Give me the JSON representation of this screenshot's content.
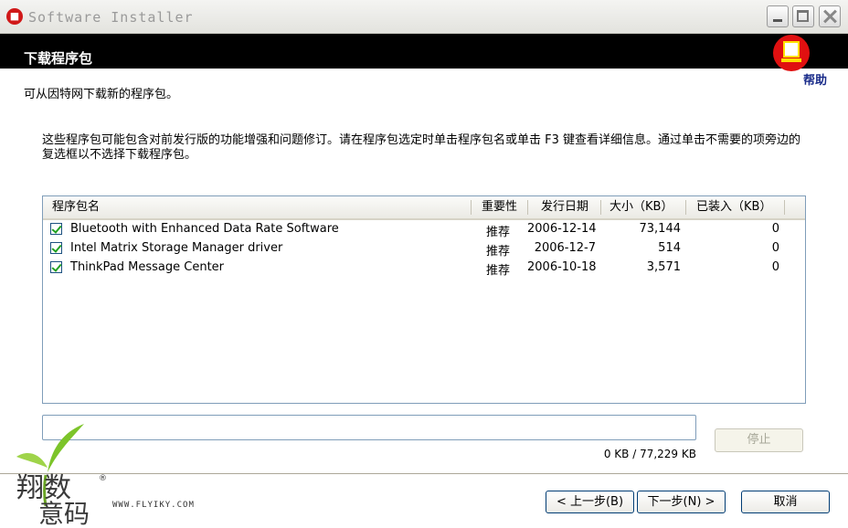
{
  "window": {
    "title": "Software Installer",
    "icon": "installer-icon"
  },
  "header": {
    "title": "下载程序包",
    "help_label": "帮助"
  },
  "subtitle": "可从因特网下载新的程序包。",
  "description": "这些程序包可能包含对前发行版的功能增强和问题修订。请在程序包选定时单击程序包名或单击 F3 键查看详细信息。通过单击不需要的项旁边的复选框以不选择下载程序包。",
  "list": {
    "columns": [
      "程序包名",
      "重要性",
      "发行日期",
      "大小（KB）",
      "已装入（KB）"
    ],
    "rows": [
      {
        "checked": true,
        "name": "Bluetooth with Enhanced Data Rate Software",
        "importance": "推荐",
        "date": "2006-12-14",
        "size": "73,144",
        "loaded": "0"
      },
      {
        "checked": true,
        "name": "Intel Matrix Storage Manager driver",
        "importance": "推荐",
        "date": "2006-12-7",
        "size": "514",
        "loaded": "0"
      },
      {
        "checked": true,
        "name": "ThinkPad Message Center",
        "importance": "推荐",
        "date": "2006-10-18",
        "size": "3,571",
        "loaded": "0"
      }
    ]
  },
  "progress": {
    "fraction": 0,
    "size_text": "0 KB / 77,229 KB"
  },
  "buttons": {
    "stop": "停止",
    "back": "< 上一步(B)",
    "next": "下一步(N) >",
    "cancel": "取消"
  },
  "watermark": {
    "brand": "翔数意码",
    "site": "WWW.FLYIKY.COM",
    "mark": "®"
  },
  "colors": {
    "header_band": "#000000",
    "help_link": "#1a2c8a",
    "check": "#21a121",
    "badge": "#e01010"
  }
}
